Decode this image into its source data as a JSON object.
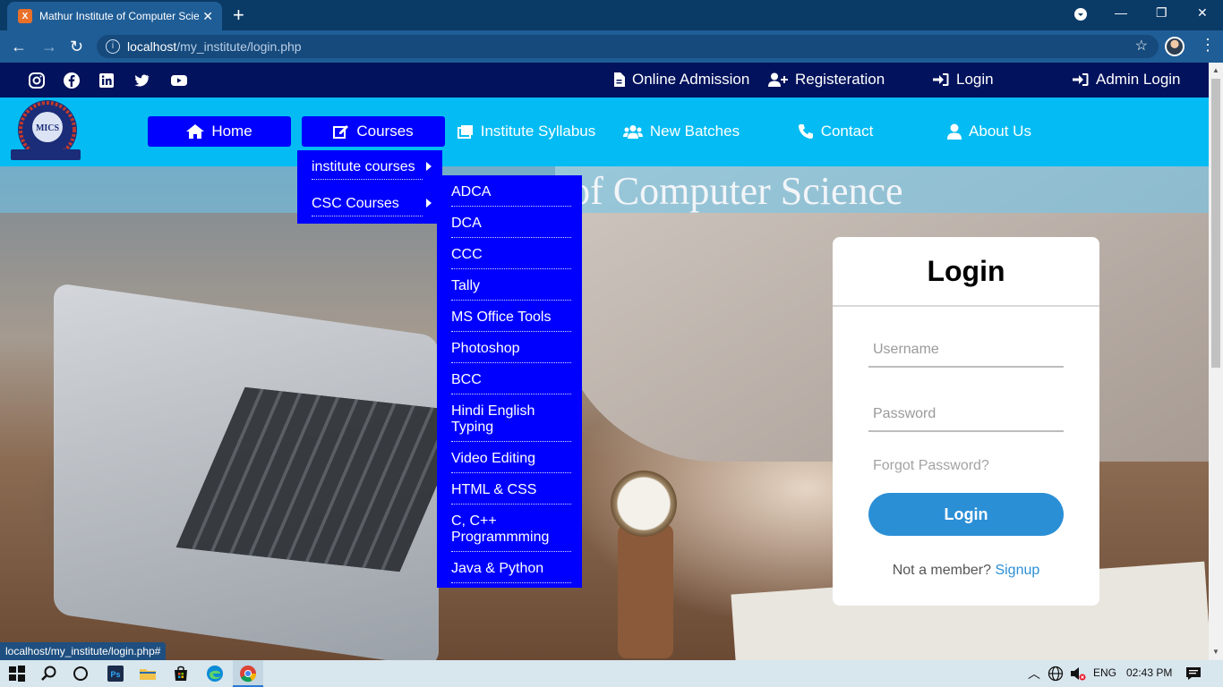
{
  "browser": {
    "tab_title": "Mathur Institute of Computer Science",
    "tab_favicon_text": "X",
    "url_host": "localhost",
    "url_path": "/my_institute/login.php",
    "accent": "#1f5d96"
  },
  "topbar": {
    "links": {
      "online_admission": "Online Admission",
      "registration": "Registeration",
      "login": "Login",
      "admin_login": "Admin Login"
    },
    "socials": [
      "instagram-icon",
      "facebook-icon",
      "linkedin-icon",
      "twitter-icon",
      "youtube-icon"
    ],
    "bg": "#02125c"
  },
  "logo": {
    "text": "MICS"
  },
  "nav": {
    "home": "Home",
    "courses": "Courses",
    "syllabus": "Institute Syllabus",
    "batches": "New Batches",
    "contact": "Contact",
    "about": "About Us",
    "bg": "#04bcf3",
    "active_bg": "#0000ff"
  },
  "banner": {
    "title": "Mathur Institute of Computer Science"
  },
  "courses_menu": {
    "items": [
      "institute courses",
      "CSC Courses"
    ]
  },
  "sub_menu": {
    "items": [
      "ADCA",
      "DCA",
      "CCC",
      "Tally",
      "MS Office Tools",
      "Photoshop",
      "BCC",
      "Hindi English Typing",
      "Video Editing",
      "HTML & CSS",
      "C, C++ Programmming",
      "Java & Python"
    ]
  },
  "login": {
    "title": "Login",
    "username_placeholder": "Username",
    "password_placeholder": "Password",
    "forgot": "Forgot Password?",
    "button": "Login",
    "not_member": "Not a member?",
    "signup": "Signup",
    "button_color": "#2b8fd6"
  },
  "status_bar": {
    "url": "localhost/my_institute/login.php#"
  },
  "taskbar": {
    "lang": "ENG",
    "time": "02:43 PM"
  }
}
